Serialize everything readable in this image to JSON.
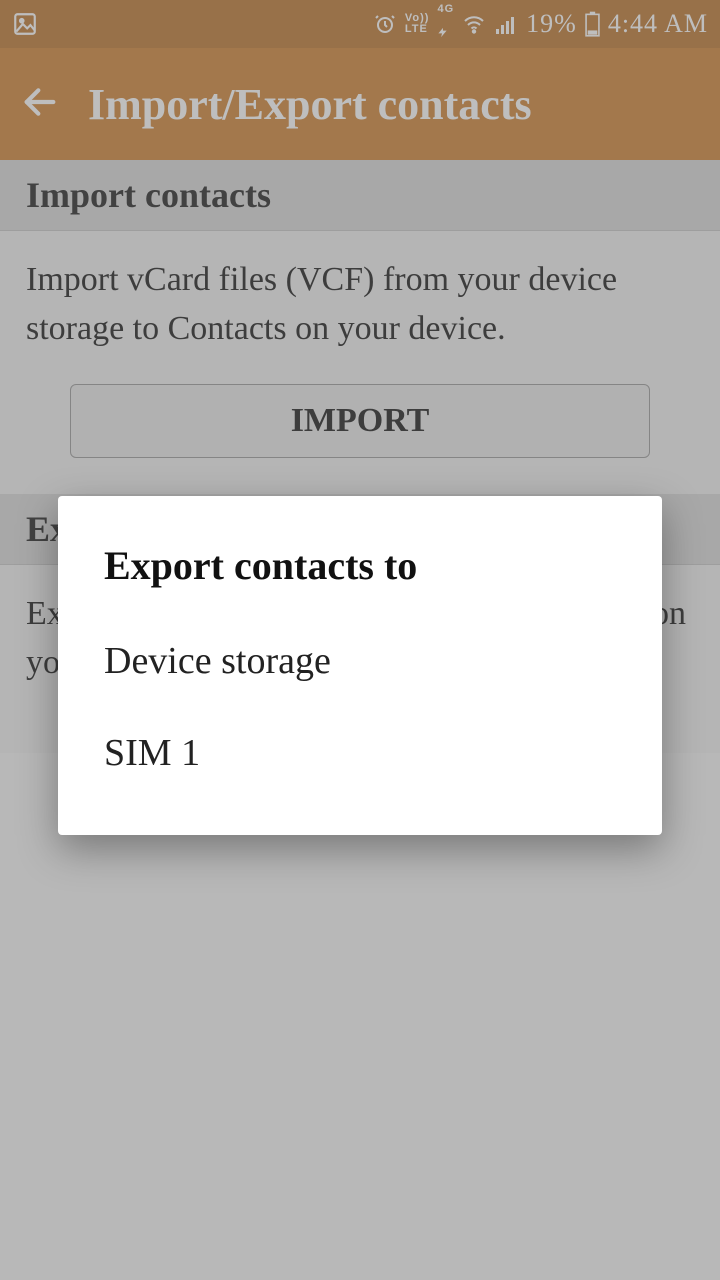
{
  "status": {
    "volte_top": "Vo))",
    "volte_bot": "LTE",
    "net_top": "4G",
    "battery_pct": "19%",
    "time": "4:44 AM"
  },
  "appbar": {
    "title": "Import/Export contacts"
  },
  "import_section": {
    "header": "Import contacts",
    "desc": "Import vCard files (VCF) from your device storage to Contacts on your device.",
    "button": "IMPORT"
  },
  "export_section": {
    "header": "Export contacts",
    "desc": "Export contacts from your device to Contacts on your device storage."
  },
  "dialog": {
    "title": "Export contacts to",
    "options": [
      "Device storage",
      "SIM 1"
    ]
  }
}
